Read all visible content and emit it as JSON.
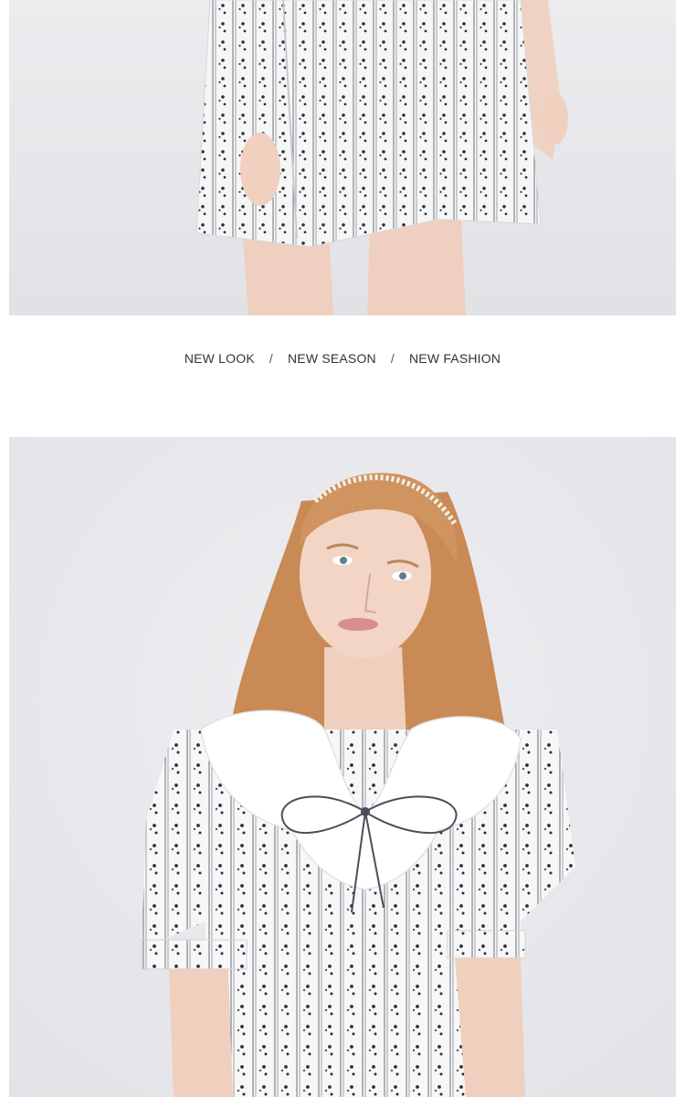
{
  "tagline": {
    "items": [
      "NEW LOOK",
      "NEW SEASON",
      "NEW FASHION"
    ],
    "separator": "/"
  },
  "colors": {
    "background": "#ffffff",
    "studio_backdrop": "#e9e9ec",
    "text": "#333333",
    "dress_base": "#f6f6f6",
    "dress_print": "#2d2f3d",
    "hair": "#c98a55",
    "skin": "#f1d3c2"
  },
  "images": [
    {
      "name": "photo-skirt-detail",
      "subject": "lower half of white dress with navy floral-stripe print"
    },
    {
      "name": "photo-model-portrait",
      "subject": "model wearing print dress with white petal collar and bow tie, pearl headband"
    }
  ]
}
